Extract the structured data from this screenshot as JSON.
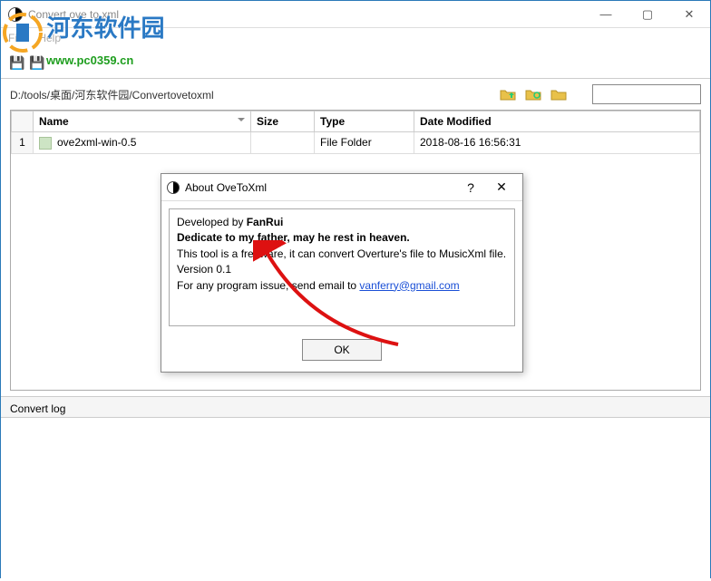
{
  "window": {
    "title": "Convert ove to xml"
  },
  "menu": {
    "file": "File",
    "help": "Help"
  },
  "path": "D:/tools/桌面/河东软件园/Convertovetoxml",
  "search": {
    "placeholder": ""
  },
  "columns": {
    "num": "",
    "name": "Name",
    "size": "Size",
    "type": "Type",
    "date": "Date Modified"
  },
  "rows": [
    {
      "num": "1",
      "name": "ove2xml-win-0.5",
      "size": "",
      "type": "File Folder",
      "date": "2018-08-16 16:56:31"
    }
  ],
  "log_label": "Convert log",
  "dialog": {
    "title": "About OveToXml",
    "line1_prefix": "Developed by ",
    "line1_author": "FanRui",
    "line2": "Dedicate to my father, may he rest in heaven.",
    "line3": "This tool is a freeware, it can convert Overture's file to MusicXml file.",
    "line4": "Version 0.1",
    "line5_prefix": "For any program issue, send email to ",
    "email": "vanferry@gmail.com",
    "ok": "OK"
  },
  "watermark": {
    "text": "河东软件园",
    "url": "www.pc0359.cn"
  }
}
